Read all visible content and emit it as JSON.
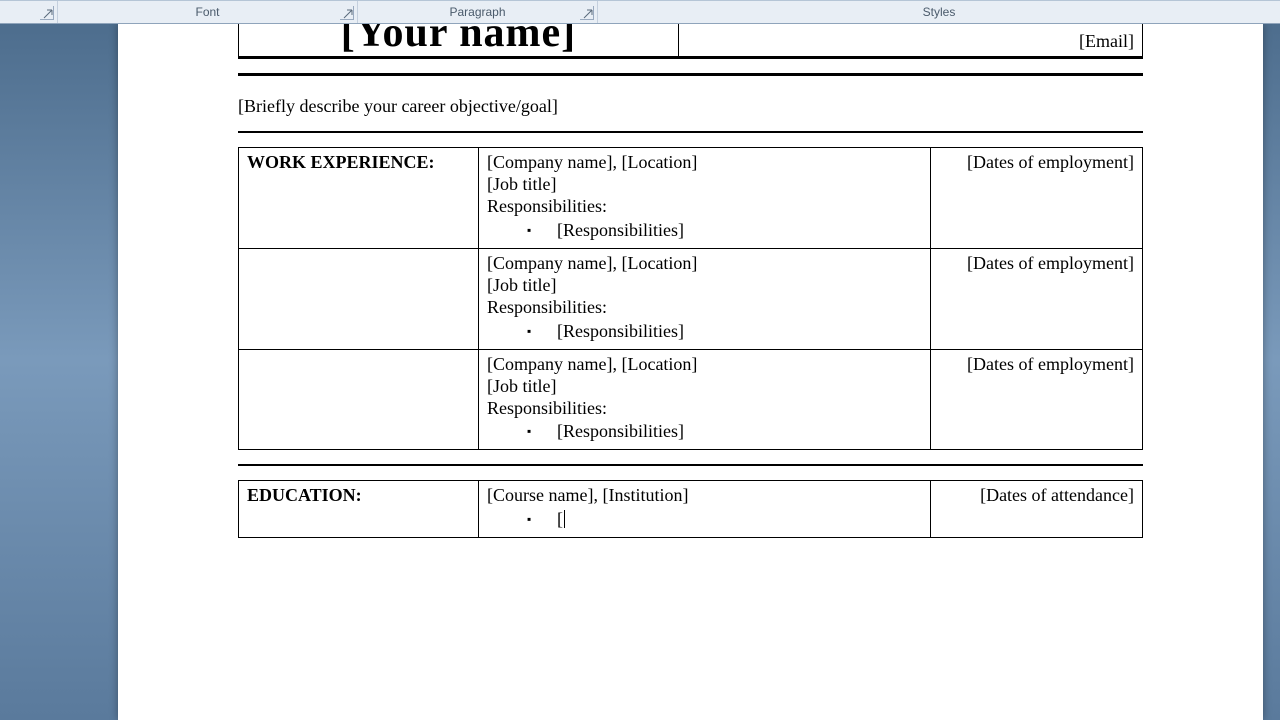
{
  "ribbon": {
    "font": "Font",
    "paragraph": "Paragraph",
    "styles": "Styles"
  },
  "header": {
    "name": "[Your name]",
    "email": "[Email]"
  },
  "objective": "[Briefly describe your career objective/goal]",
  "work": {
    "label": "WORK EXPERIENCE:",
    "rows": [
      {
        "company": "[Company name], [Location]",
        "title": "[Job title]",
        "resp_label": "Responsibilities:",
        "resp_item": "[Responsibilities]",
        "dates": "[Dates of employment]"
      },
      {
        "company": "[Company name], [Location]",
        "title": "[Job title]",
        "resp_label": "Responsibilities:",
        "resp_item": "[Responsibilities]",
        "dates": "[Dates of employment]"
      },
      {
        "company": "[Company name], [Location]",
        "title": "[Job title]",
        "resp_label": "Responsibilities:",
        "resp_item": "[Responsibilities]",
        "dates": "[Dates of employment]"
      }
    ]
  },
  "education": {
    "label": "EDUCATION:",
    "course": "[Course name], [Institution]",
    "detail": "[",
    "dates": "[Dates of attendance]"
  }
}
